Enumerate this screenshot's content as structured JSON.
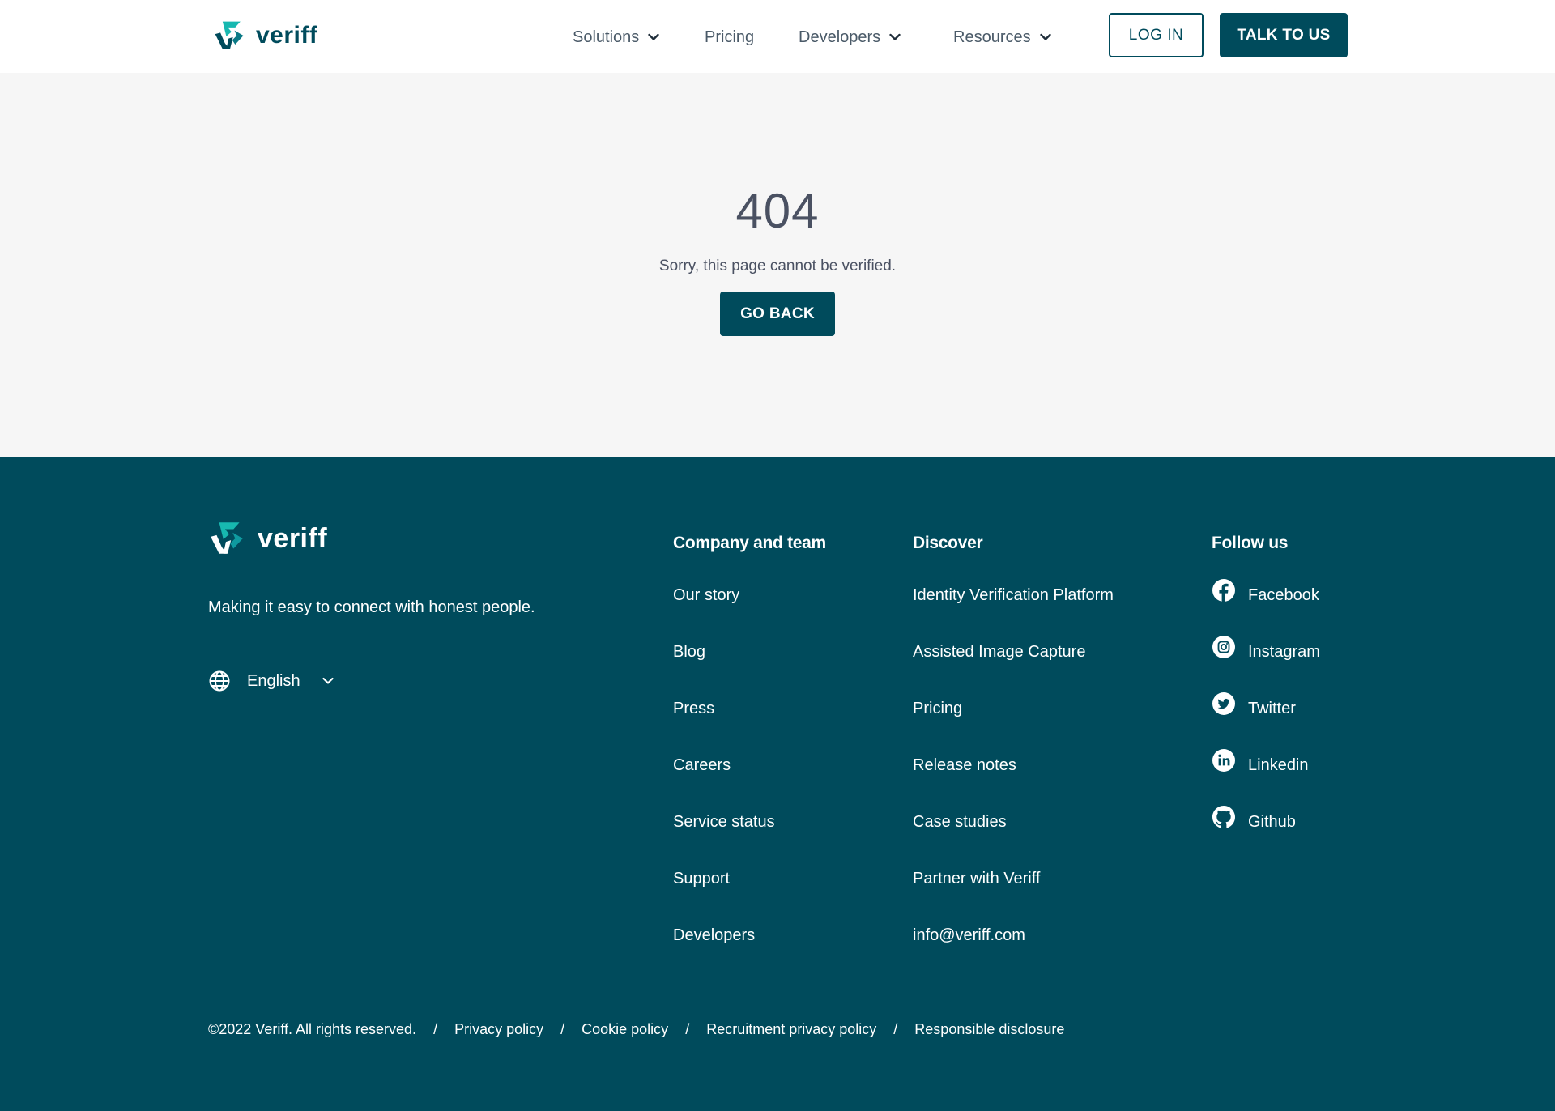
{
  "header": {
    "logo_text": "veriff",
    "nav": [
      {
        "label": "Solutions",
        "has_dropdown": true
      },
      {
        "label": "Pricing",
        "has_dropdown": false
      },
      {
        "label": "Developers",
        "has_dropdown": true
      },
      {
        "label": "Resources",
        "has_dropdown": true
      }
    ],
    "login_label": "LOG IN",
    "talk_label": "TALK TO US"
  },
  "error": {
    "code": "404",
    "message": "Sorry, this page cannot be verified.",
    "back_label": "GO BACK"
  },
  "footer": {
    "logo_text": "veriff",
    "tagline": "Making it easy to connect with honest people.",
    "language": {
      "icon": "globe-icon",
      "label": "English"
    },
    "columns": {
      "company": {
        "title": "Company and team",
        "links": [
          "Our story",
          "Blog",
          "Press",
          "Careers",
          "Service status",
          "Support",
          "Developers"
        ]
      },
      "discover": {
        "title": "Discover",
        "links": [
          "Identity Verification Platform",
          "Assisted Image Capture",
          "Pricing",
          "Release notes",
          "Case studies",
          "Partner with Veriff",
          "info@veriff.com"
        ]
      },
      "follow": {
        "title": "Follow us",
        "links": [
          {
            "label": "Facebook",
            "icon": "facebook-icon"
          },
          {
            "label": "Instagram",
            "icon": "instagram-icon"
          },
          {
            "label": "Twitter",
            "icon": "twitter-icon"
          },
          {
            "label": "Linkedin",
            "icon": "linkedin-icon"
          },
          {
            "label": "Github",
            "icon": "github-icon"
          }
        ]
      }
    },
    "legal": {
      "copyright": "©2022 Veriff. All rights reserved.",
      "separator": "/",
      "links": [
        "Privacy policy",
        "Cookie policy",
        "Recruitment privacy policy",
        "Responsible disclosure"
      ]
    }
  },
  "colors": {
    "brand": "#004b5c",
    "accent": "#17b8b0",
    "hero_bg": "#f6f6f6",
    "text_muted": "#4a5a68"
  }
}
